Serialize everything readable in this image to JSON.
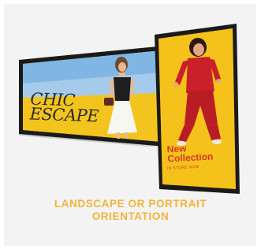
{
  "landscape_screen": {
    "headline_line1": "CHIC",
    "headline_line2": "ESCAPE"
  },
  "portrait_screen": {
    "headline_line1": "New",
    "headline_line2": "Collection",
    "subline": "IN STORE NOW"
  },
  "caption": {
    "line1": "LANDSCAPE OR PORTRAIT",
    "line2": "ORIENTATION"
  },
  "colors": {
    "accent": "#f2b43a",
    "promo_red": "#d63a23",
    "backdrop_yellow": "#f5c21b",
    "bezel": "#1a1a1a",
    "card_bg": "#f3f3f3"
  }
}
